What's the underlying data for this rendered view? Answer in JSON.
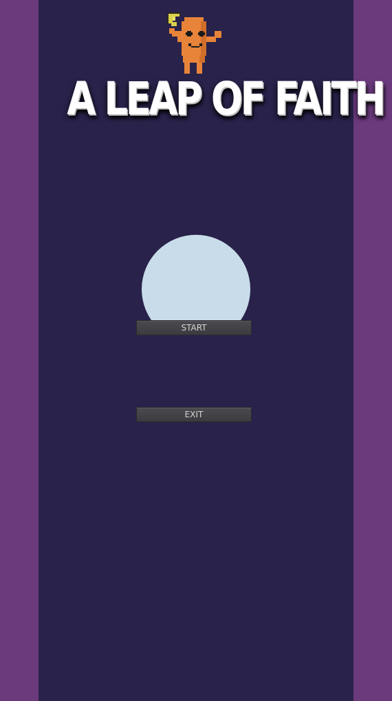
{
  "game": {
    "title": "A LEAP OF FAITH",
    "mascot_icon": "carrot-character-icon",
    "orb_icon": "moon-orb-icon"
  },
  "menu": {
    "start_label": "START",
    "exit_label": "EXIT"
  },
  "colors": {
    "play_area": "#29224a",
    "side_bars": "#6b3a7d",
    "orb": "#c8dde9",
    "mascot": "#e8843a",
    "button": "#434348"
  }
}
